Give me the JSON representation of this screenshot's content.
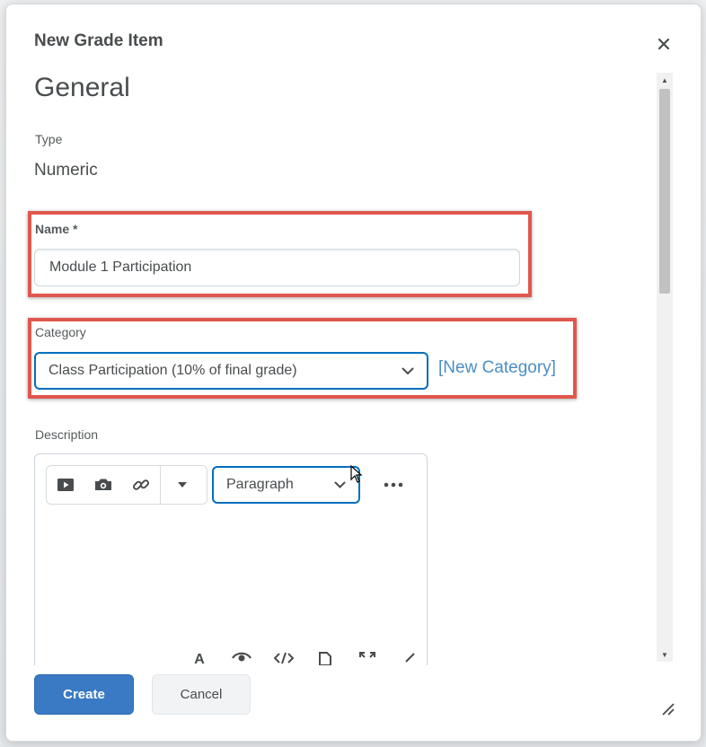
{
  "dialog": {
    "title": "New Grade Item",
    "close_icon": "close-icon"
  },
  "section": {
    "heading": "General"
  },
  "type_field": {
    "label": "Type",
    "value": "Numeric"
  },
  "name_field": {
    "label": "Name *",
    "value": "Module 1 Participation"
  },
  "category_field": {
    "label": "Category",
    "selected": "Class Participation (10% of final grade)",
    "new_link": "[New Category]"
  },
  "description_field": {
    "label": "Description",
    "toolbar": {
      "icons": [
        "video-icon",
        "camera-icon",
        "link-icon",
        "chevron-down-icon"
      ],
      "format_selected": "Paragraph",
      "more_icon": "more-options-icon"
    }
  },
  "footer": {
    "create_label": "Create",
    "cancel_label": "Cancel"
  },
  "colors": {
    "highlight": "#e0574d",
    "primary": "#3a7ac4",
    "focus": "#006fbf",
    "link": "#4a8ec7"
  }
}
